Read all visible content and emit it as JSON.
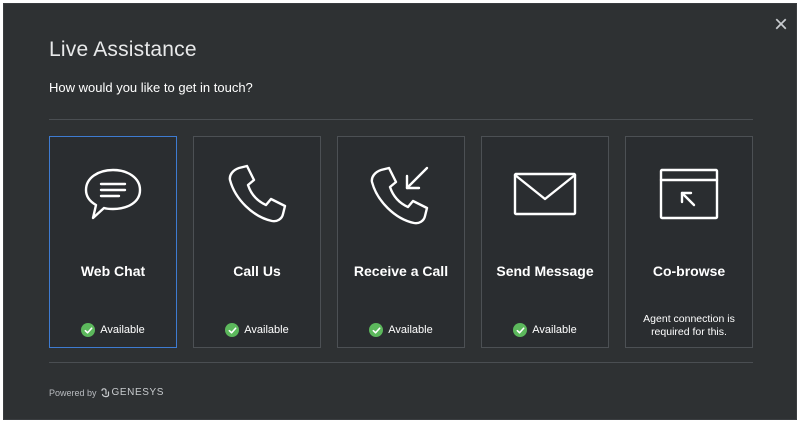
{
  "dialog": {
    "title": "Live Assistance",
    "subtitle": "How would you like to get in touch?",
    "close_icon": "×"
  },
  "options": [
    {
      "label": "Web Chat",
      "status": "Available",
      "icon": "chat-bubble-icon",
      "selected": true
    },
    {
      "label": "Call Us",
      "status": "Available",
      "icon": "phone-icon",
      "selected": false
    },
    {
      "label": "Receive a Call",
      "status": "Available",
      "icon": "incoming-call-icon",
      "selected": false
    },
    {
      "label": "Send Message",
      "status": "Available",
      "icon": "envelope-icon",
      "selected": false
    },
    {
      "label": "Co-browse",
      "note": "Agent connection is required for this.",
      "icon": "cobrowse-window-icon",
      "selected": false
    }
  ],
  "footer": {
    "powered_by": "Powered by",
    "brand": "GENESYS",
    "logo_icon": "genesys-logo-icon"
  },
  "colors": {
    "background": "#2e3133",
    "card": "#2a2d30",
    "selected_border": "#3e7bd1",
    "available_green": "#5cb85c"
  }
}
